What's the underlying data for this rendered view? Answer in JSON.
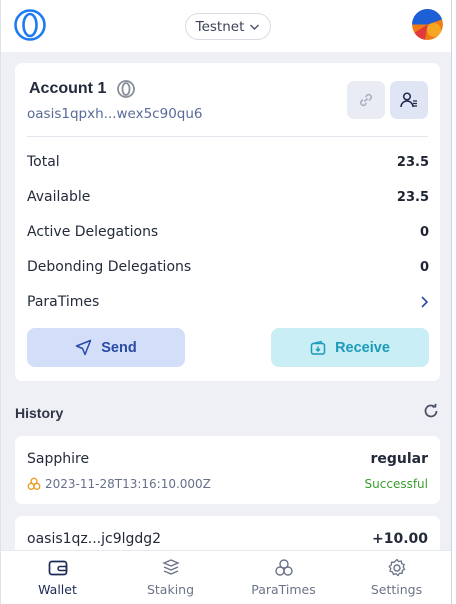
{
  "header": {
    "network_label": "Testnet"
  },
  "account": {
    "name": "Account 1",
    "address": "oasis1qpxh...wex5c90qu6"
  },
  "balances": [
    {
      "label": "Total",
      "value": "23.5"
    },
    {
      "label": "Available",
      "value": "23.5"
    },
    {
      "label": "Active Delegations",
      "value": "0"
    },
    {
      "label": "Debonding Delegations",
      "value": "0"
    }
  ],
  "paratimes_row": {
    "label": "ParaTimes"
  },
  "actions": {
    "send_label": "Send",
    "receive_label": "Receive"
  },
  "history": {
    "title": "History",
    "items": [
      {
        "title": "Sapphire",
        "type": "regular",
        "date": "2023-11-28T13:16:10.000Z",
        "status": "Successful"
      },
      {
        "title": "oasis1qz...jc9lgdg2",
        "amount": "+10.00"
      }
    ]
  },
  "nav": {
    "items": [
      {
        "label": "Wallet",
        "icon": "wallet-icon"
      },
      {
        "label": "Staking",
        "icon": "staking-icon"
      },
      {
        "label": "ParaTimes",
        "icon": "paratimes-icon"
      },
      {
        "label": "Settings",
        "icon": "settings-icon"
      }
    ],
    "active": "Wallet"
  },
  "colors": {
    "accent": "#2b4aa8",
    "receive": "#1c9ab8",
    "success": "#3a9e2e"
  }
}
